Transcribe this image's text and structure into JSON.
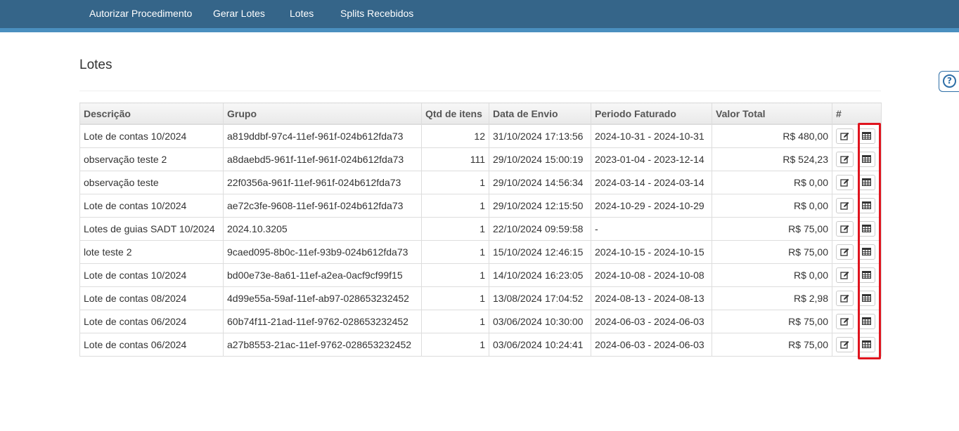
{
  "nav": {
    "items": [
      {
        "label": "Autorizar Procedimento"
      },
      {
        "label": "Gerar Lotes"
      },
      {
        "label": "Lotes"
      },
      {
        "label": "Splits Recebidos"
      }
    ]
  },
  "page": {
    "title": "Lotes",
    "help_icon": "question-circle-icon"
  },
  "table": {
    "headers": [
      "Descrição",
      "Grupo",
      "Qtd de itens",
      "Data de Envio",
      "Periodo Faturado",
      "Valor Total",
      "#"
    ],
    "action_icons": [
      "edit-icon",
      "table-icon"
    ],
    "rows": [
      {
        "descricao": "Lote de contas 10/2024",
        "grupo": "a819ddbf-97c4-11ef-961f-024b612fda73",
        "qtd": "12",
        "data_envio": "31/10/2024 17:13:56",
        "periodo": "2024-10-31 - 2024-10-31",
        "valor": "R$ 480,00"
      },
      {
        "descricao": "observação teste 2",
        "grupo": "a8daebd5-961f-11ef-961f-024b612fda73",
        "qtd": "111",
        "data_envio": "29/10/2024 15:00:19",
        "periodo": "2023-01-04 - 2023-12-14",
        "valor": "R$ 524,23"
      },
      {
        "descricao": "observação teste",
        "grupo": "22f0356a-961f-11ef-961f-024b612fda73",
        "qtd": "1",
        "data_envio": "29/10/2024 14:56:34",
        "periodo": "2024-03-14 - 2024-03-14",
        "valor": "R$ 0,00"
      },
      {
        "descricao": "Lote de contas 10/2024",
        "grupo": "ae72c3fe-9608-11ef-961f-024b612fda73",
        "qtd": "1",
        "data_envio": "29/10/2024 12:15:50",
        "periodo": "2024-10-29 - 2024-10-29",
        "valor": "R$ 0,00"
      },
      {
        "descricao": "Lotes de guias SADT 10/2024",
        "grupo": "2024.10.3205",
        "qtd": "1",
        "data_envio": "22/10/2024 09:59:58",
        "periodo": "-",
        "valor": "R$ 75,00"
      },
      {
        "descricao": "lote teste 2",
        "grupo": "9caed095-8b0c-11ef-93b9-024b612fda73",
        "qtd": "1",
        "data_envio": "15/10/2024 12:46:15",
        "periodo": "2024-10-15 - 2024-10-15",
        "valor": "R$ 75,00"
      },
      {
        "descricao": "Lote de contas 10/2024",
        "grupo": "bd00e73e-8a61-11ef-a2ea-0acf9cf99f15",
        "qtd": "1",
        "data_envio": "14/10/2024 16:23:05",
        "periodo": "2024-10-08 - 2024-10-08",
        "valor": "R$ 0,00"
      },
      {
        "descricao": "Lote de contas 08/2024",
        "grupo": "4d99e55a-59af-11ef-ab97-028653232452",
        "qtd": "1",
        "data_envio": "13/08/2024 17:04:52",
        "periodo": "2024-08-13 - 2024-08-13",
        "valor": "R$ 2,98"
      },
      {
        "descricao": "Lote de contas 06/2024",
        "grupo": "60b74f11-21ad-11ef-9762-028653232452",
        "qtd": "1",
        "data_envio": "03/06/2024 10:30:00",
        "periodo": "2024-06-03 - 2024-06-03",
        "valor": "R$ 75,00"
      },
      {
        "descricao": "Lote de contas 06/2024",
        "grupo": "a27b8553-21ac-11ef-9762-028653232452",
        "qtd": "1",
        "data_envio": "03/06/2024 10:24:41",
        "periodo": "2024-06-03 - 2024-06-03",
        "valor": "R$ 75,00"
      }
    ]
  },
  "colors": {
    "nav_bg": "#356589",
    "nav_accent": "#4a8fbf",
    "highlight": "#e0141e"
  }
}
